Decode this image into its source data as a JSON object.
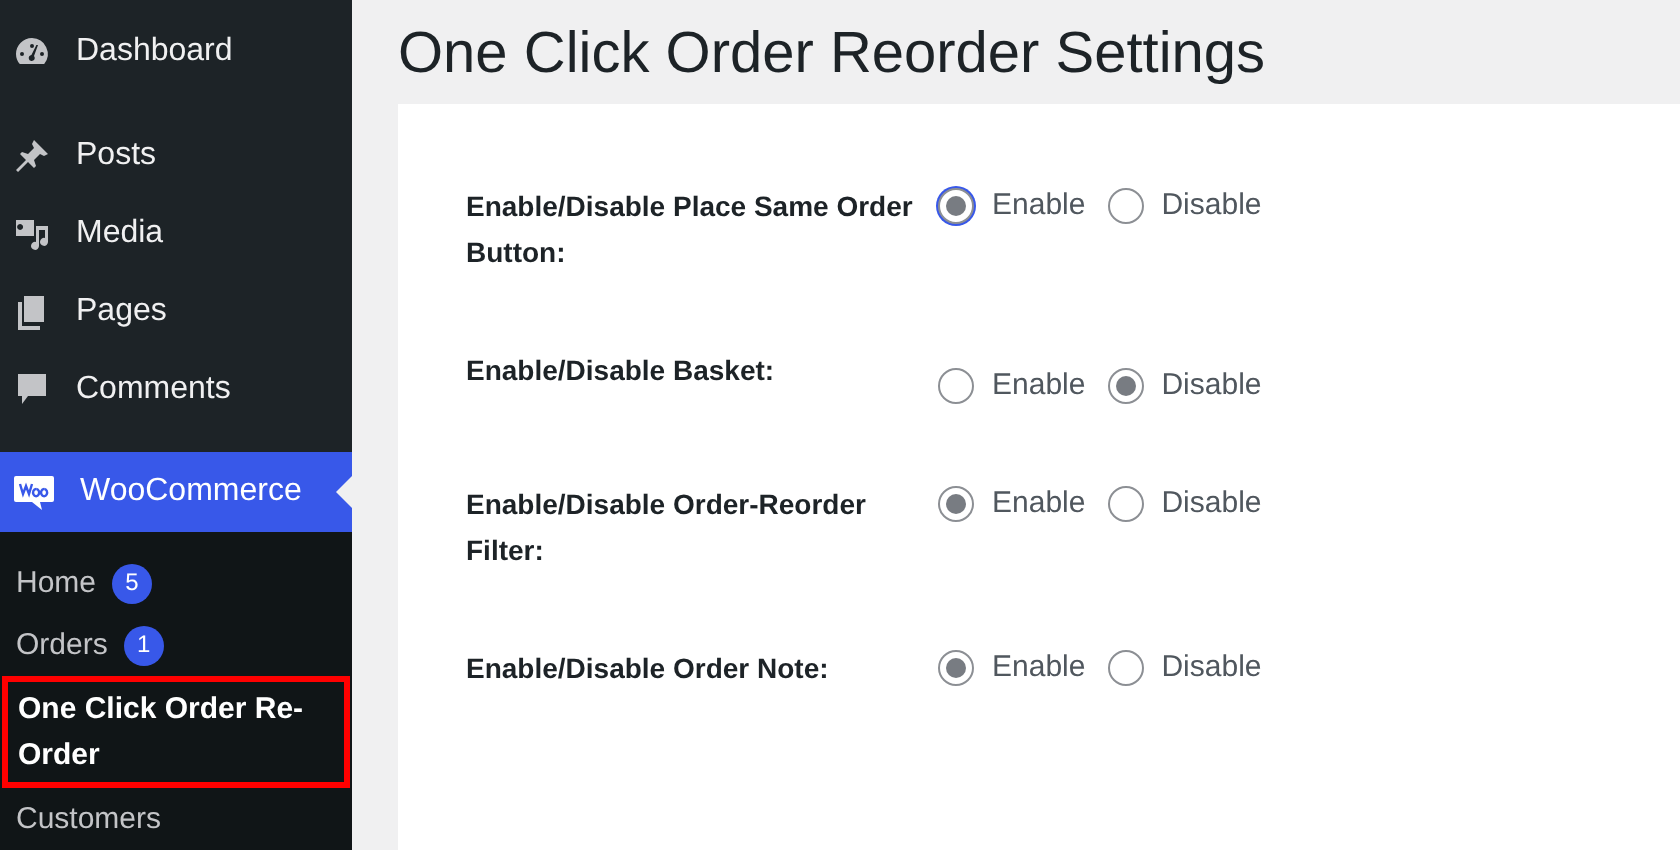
{
  "sidebar": {
    "items": [
      {
        "label": "Dashboard",
        "selected": false
      },
      {
        "label": "Posts",
        "selected": false
      },
      {
        "label": "Media",
        "selected": false
      },
      {
        "label": "Pages",
        "selected": false
      },
      {
        "label": "Comments",
        "selected": false
      },
      {
        "label": "WooCommerce",
        "selected": true
      }
    ],
    "submenu": [
      {
        "label": "Home",
        "badge": "5",
        "selected": false,
        "highlighted": false
      },
      {
        "label": "Orders",
        "badge": "1",
        "selected": false,
        "highlighted": false
      },
      {
        "label": "One Click Order Re-Order",
        "selected": true,
        "highlighted": true
      },
      {
        "label": "Customers",
        "selected": false,
        "highlighted": false
      }
    ]
  },
  "page_title": "One Click Order Reorder Settings",
  "settings": [
    {
      "label": "Enable/Disable Place Same Order Button:",
      "options": [
        {
          "label": "Enable",
          "selected": true,
          "focused": true
        },
        {
          "label": "Disable",
          "selected": false,
          "focused": false
        }
      ]
    },
    {
      "label": "Enable/Disable Basket:",
      "options": [
        {
          "label": "Enable",
          "selected": false,
          "focused": false
        },
        {
          "label": "Disable",
          "selected": true,
          "focused": false
        }
      ]
    },
    {
      "label": "Enable/Disable Order-Reorder Filter:",
      "options": [
        {
          "label": "Enable",
          "selected": true,
          "focused": false
        },
        {
          "label": "Disable",
          "selected": false,
          "focused": false
        }
      ]
    },
    {
      "label": "Enable/Disable Order Note:",
      "options": [
        {
          "label": "Enable",
          "selected": true,
          "focused": false
        },
        {
          "label": "Disable",
          "selected": false,
          "focused": false
        }
      ]
    }
  ]
}
